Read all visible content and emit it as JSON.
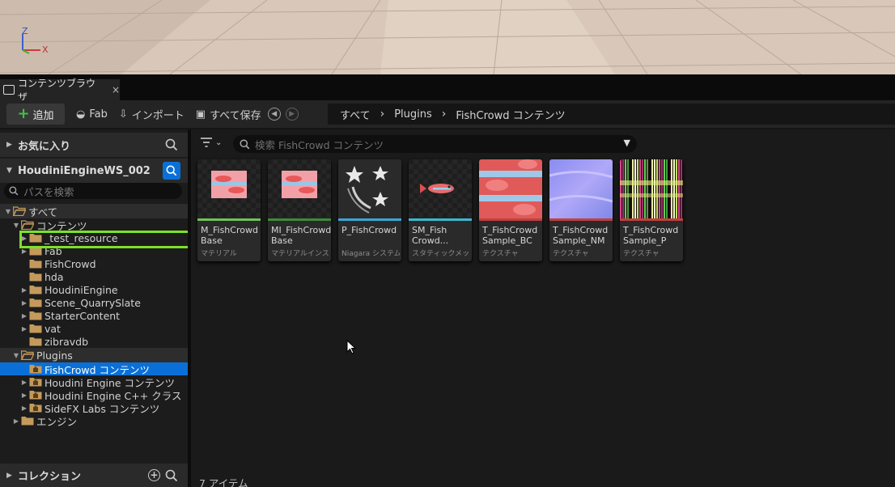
{
  "viewport": {
    "axis_z": "Z",
    "axis_x": "X"
  },
  "tab": {
    "label": "コンテンツブラウザ",
    "close": "×"
  },
  "toolbar": {
    "add": "追加",
    "fab": "Fab",
    "import": "インポート",
    "save_all": "すべて保存"
  },
  "breadcrumb": [
    "すべて",
    "Plugins",
    "FishCrowd コンテンツ"
  ],
  "left": {
    "favorites": "お気に入り",
    "project": "HoudiniEngineWS_002",
    "path_search_placeholder": "パスを検索",
    "collections": "コレクション",
    "tree": [
      {
        "label": "すべて",
        "depth": 0,
        "arrow": "open",
        "root": true
      },
      {
        "label": "コンテンツ",
        "depth": 1,
        "arrow": "open"
      },
      {
        "label": "_test_resource",
        "depth": 2,
        "arrow": "closed"
      },
      {
        "label": "Fab",
        "depth": 2,
        "arrow": "closed"
      },
      {
        "label": "FishCrowd",
        "depth": 2,
        "arrow": "none"
      },
      {
        "label": "hda",
        "depth": 2,
        "arrow": "none"
      },
      {
        "label": "HoudiniEngine",
        "depth": 2,
        "arrow": "closed"
      },
      {
        "label": "Scene_QuarrySlate",
        "depth": 2,
        "arrow": "closed"
      },
      {
        "label": "StarterContent",
        "depth": 2,
        "arrow": "closed"
      },
      {
        "label": "vat",
        "depth": 2,
        "arrow": "closed"
      },
      {
        "label": "zibravdb",
        "depth": 2,
        "arrow": "none"
      },
      {
        "label": "Plugins",
        "depth": 1,
        "arrow": "open",
        "root": true
      },
      {
        "label": "FishCrowd コンテンツ",
        "depth": 2,
        "arrow": "none",
        "selected": true,
        "plugin": true
      },
      {
        "label": "Houdini Engine コンテンツ",
        "depth": 2,
        "arrow": "closed",
        "plugin": true
      },
      {
        "label": "Houdini Engine C++ クラス",
        "depth": 2,
        "arrow": "closed",
        "plugin": true
      },
      {
        "label": "SideFX Labs コンテンツ",
        "depth": 2,
        "arrow": "closed",
        "plugin": true
      },
      {
        "label": "エンジン",
        "depth": 1,
        "arrow": "closed"
      }
    ]
  },
  "right": {
    "search_placeholder": "検索 FishCrowd コンテンツ",
    "item_count": "7 アイテム",
    "assets": [
      {
        "name": "M_FishCrowd Base",
        "type": "マテリアル",
        "strip": "#6fc25a",
        "thumb": "material"
      },
      {
        "name": "MI_FishCrowd Base",
        "type": "マテリアルインス...",
        "strip": "#3f8a3a",
        "thumb": "material"
      },
      {
        "name": "P_FishCrowd",
        "type": "Niagara システム",
        "strip": "#3aa6d6",
        "thumb": "niagara"
      },
      {
        "name": "SM_Fish Crowd...",
        "type": "スタティックメッ...",
        "strip": "#3cb8d0",
        "thumb": "mesh"
      },
      {
        "name": "T_FishCrowd Sample_BC",
        "type": "テクスチャ",
        "strip": "#c04040",
        "thumb": "bc"
      },
      {
        "name": "T_FishCrowd Sample_NM",
        "type": "テクスチャ",
        "strip": "#c04040",
        "thumb": "nm"
      },
      {
        "name": "T_FishCrowd Sample_P",
        "type": "テクスチャ",
        "strip": "#c04040",
        "thumb": "p"
      }
    ]
  },
  "colors": {
    "accent": "#0a70d8",
    "highlight": "#7ee02a"
  }
}
